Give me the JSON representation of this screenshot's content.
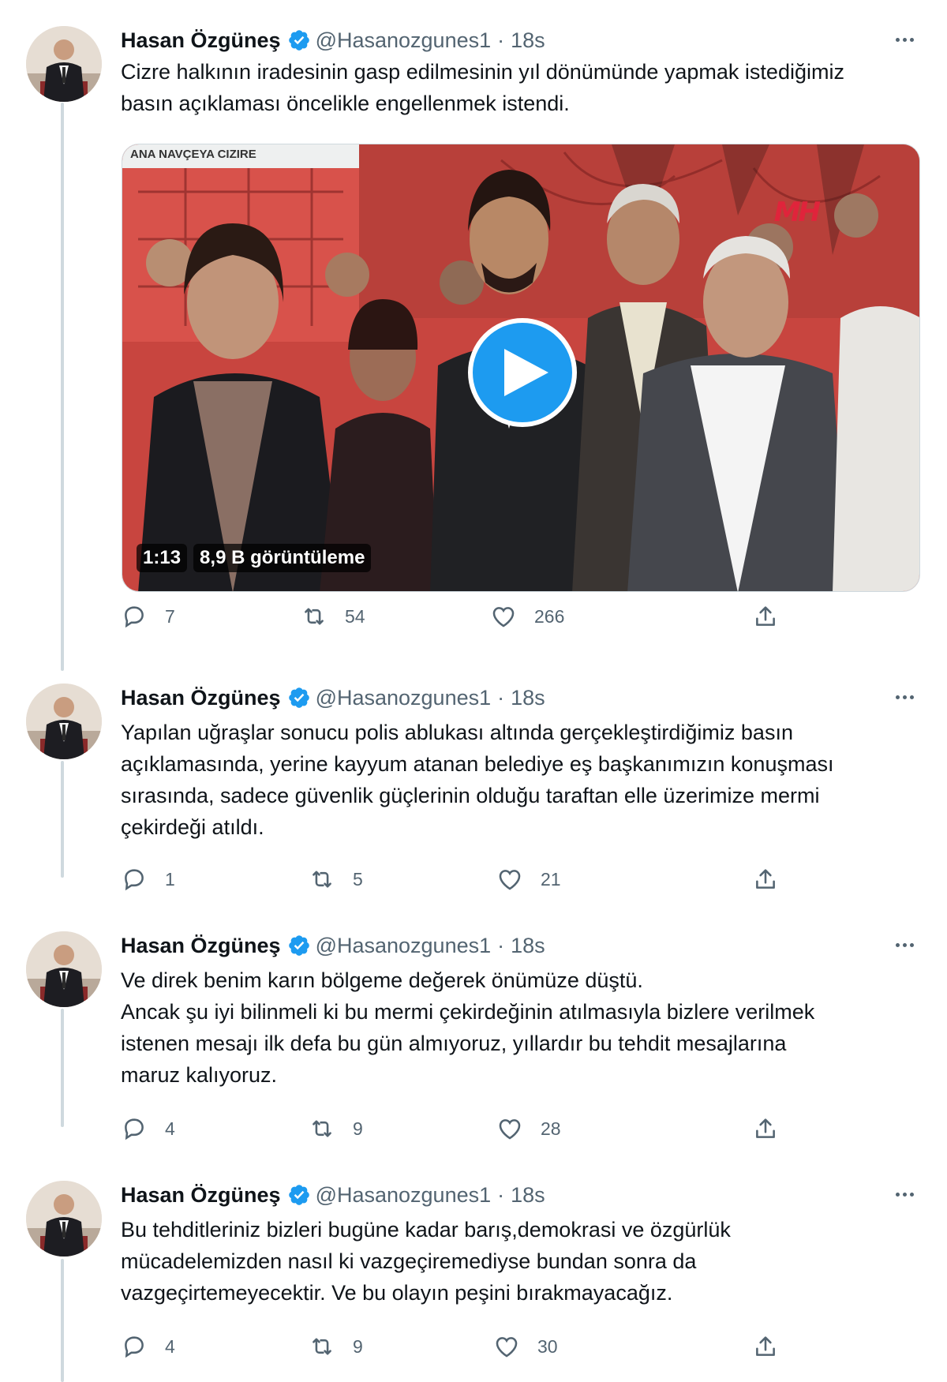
{
  "tweets": [
    {
      "author": {
        "name": "Hasan Özgüneş",
        "handle": "@Hasanozgunes1",
        "time": "18s"
      },
      "lines": [
        "Cizre halkının iradesinin gasp edilmesinin yıl dönümünde yapmak istediğimiz",
        "basın açıklaması öncelikle engellenmek istendi."
      ],
      "media": {
        "type": "video",
        "duration": "1:13",
        "views": "8,9 B görüntüleme",
        "watermark": "MH",
        "sign_text": "ANA NAVÇEYA CIZIRE"
      },
      "stats": {
        "replies": "7",
        "retweets": "54",
        "likes": "266"
      }
    },
    {
      "author": {
        "name": "Hasan Özgüneş",
        "handle": "@Hasanozgunes1",
        "time": "18s"
      },
      "lines": [
        "Yapılan uğraşlar sonucu polis ablukası altında gerçekleştirdiğimiz basın",
        "açıklamasında, yerine kayyum atanan belediye eş başkanımızın konuşması",
        "sırasında, sadece güvenlik güçlerinin olduğu taraftan elle üzerimize mermi",
        "çekirdeği atıldı."
      ],
      "stats": {
        "replies": "1",
        "retweets": "5",
        "likes": "21"
      }
    },
    {
      "author": {
        "name": "Hasan Özgüneş",
        "handle": "@Hasanozgunes1",
        "time": "18s"
      },
      "lines": [
        "Ve direk benim karın bölgeme değerek önümüze düştü.",
        "Ancak şu iyi bilinmeli ki bu mermi çekirdeğinin atılmasıyla  bizlere verilmek",
        "istenen  mesajı ilk defa bu gün almıyoruz, yıllardır bu tehdit mesajlarına",
        "maruz kalıyoruz."
      ],
      "stats": {
        "replies": "4",
        "retweets": "9",
        "likes": "28"
      }
    },
    {
      "author": {
        "name": "Hasan Özgüneş",
        "handle": "@Hasanozgunes1",
        "time": "18s"
      },
      "lines": [
        "Bu tehditleriniz bizleri bugüne kadar barış,demokrasi ve özgürlük",
        "mücadelemizden nasıl ki vazgeçiremediyse bundan sonra da",
        "vazgeçirtemeyecektir. Ve bu olayın peşini bırakmayacağız."
      ],
      "stats": {
        "replies": "4",
        "retweets": "9",
        "likes": "30"
      }
    }
  ],
  "icons": {
    "verified": "verified-badge-icon",
    "reply": "reply-icon",
    "retweet": "retweet-icon",
    "like": "heart-icon",
    "share": "share-icon",
    "more": "more-options-icon",
    "play": "play-icon"
  },
  "colors": {
    "accent": "#1d9bf0",
    "text": "#0f1419",
    "muted": "#536471",
    "thread_line": "#cfd9de"
  }
}
